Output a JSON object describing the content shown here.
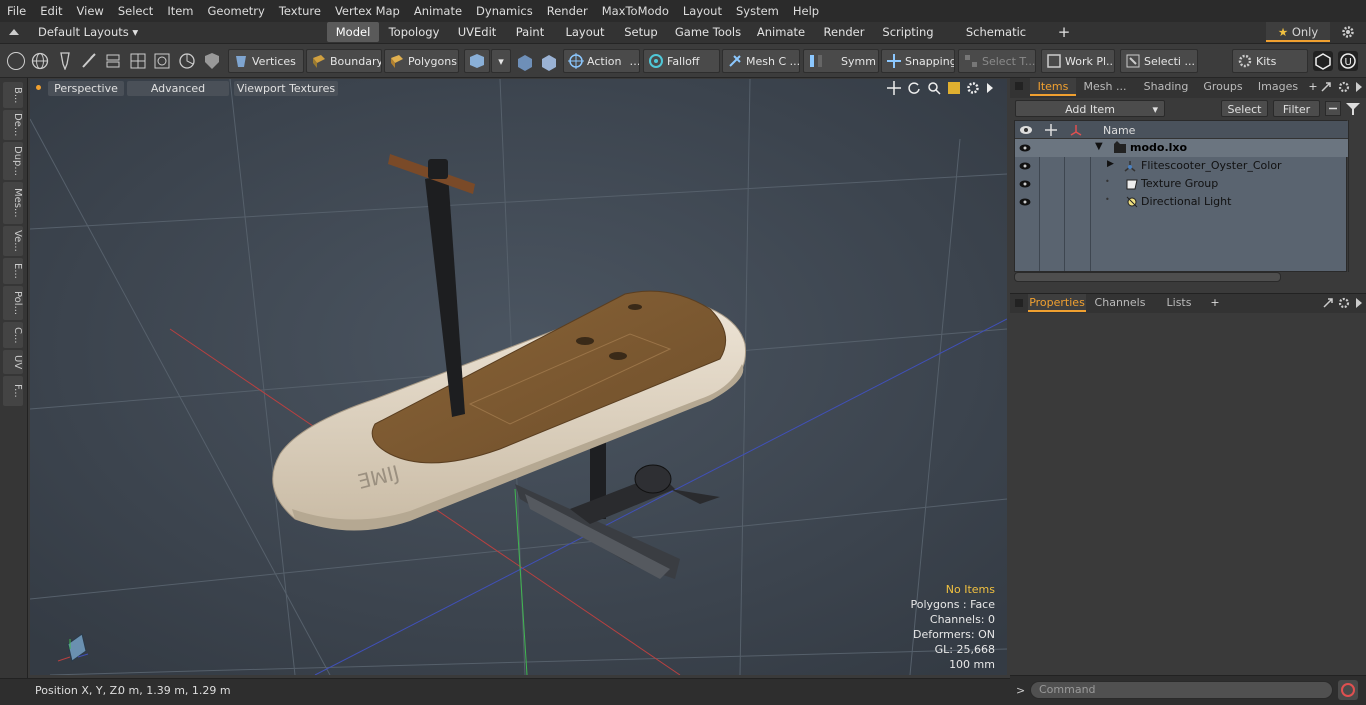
{
  "menu": [
    "File",
    "Edit",
    "View",
    "Select",
    "Item",
    "Geometry",
    "Texture",
    "Vertex Map",
    "Animate",
    "Dynamics",
    "Render",
    "MaxToModo",
    "Layout",
    "System",
    "Help"
  ],
  "layout_selector": "Default Layouts",
  "layout_tabs": [
    "Model",
    "Topology",
    "UVEdit",
    "Paint",
    "Layout",
    "Setup",
    "Game Tools",
    "Animate",
    "Render",
    "Scripting",
    "Schematic Fusion"
  ],
  "only_label": "Only",
  "toolbar": {
    "vertices": "Vertices",
    "boundary": "Boundary",
    "polygons": "Polygons",
    "action": "Action",
    "falloff": "Falloff",
    "mesh": "Mesh C ...",
    "symm": "Symm ...",
    "snapping": "Snapping",
    "select_t": "Select T...",
    "work_pl": "Work Pl...",
    "selecti": "Selecti ...",
    "kits": "Kits"
  },
  "left_tabs": [
    "B...",
    "De...",
    "Dup...",
    "Mes...",
    "Ve...",
    "E...",
    "Pol...",
    "C...",
    "UV",
    "F..."
  ],
  "viewport": {
    "mode": "Perspective",
    "shading": "Advanced",
    "textures": "Viewport Textures",
    "stats": [
      "No Items",
      "Polygons : Face",
      "Channels: 0",
      "Deformers: ON",
      "GL: 25,668",
      "100 mm"
    ],
    "highlight_color": "#f0c040"
  },
  "status": {
    "position_label": "Position X, Y, Z:",
    "position_value": "0 m, 1.39 m, 1.29 m"
  },
  "items_panel": {
    "tabs": [
      "Items",
      "Mesh ...",
      "Shading",
      "Groups",
      "Images"
    ],
    "add_item": "Add Item",
    "select": "Select",
    "filter": "Filter",
    "name_header": "Name",
    "rows": [
      {
        "label": "modo.lxo",
        "icon": "scene-icon"
      },
      {
        "label": "Flitescooter_Oyster_Color",
        "icon": "mesh-icon"
      },
      {
        "label": "Texture Group",
        "icon": "texture-group-icon"
      },
      {
        "label": "Directional Light",
        "icon": "light-icon"
      }
    ]
  },
  "properties_panel": {
    "tabs": [
      "Properties",
      "Channels",
      "Lists"
    ]
  },
  "command_placeholder": "Command"
}
